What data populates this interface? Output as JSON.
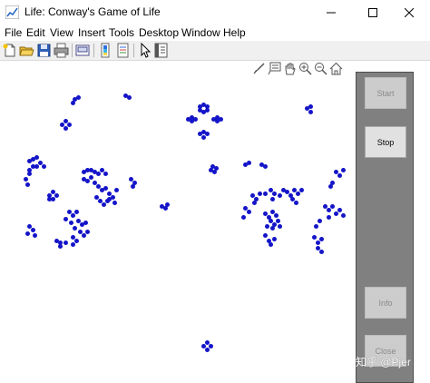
{
  "window": {
    "title": "Life: Conway's Game of Life",
    "controls": [
      "minimize",
      "maximize",
      "close"
    ]
  },
  "menu": [
    "File",
    "Edit",
    "View",
    "Insert",
    "Tools",
    "Desktop",
    "Window",
    "Help"
  ],
  "toolbar": [
    "new-figure-icon",
    "open-file-icon",
    "save-icon",
    "print-icon",
    "link-plot-icon",
    "insert-colorbar-icon",
    "insert-legend-icon",
    "edit-plot-icon",
    "open-property-inspector-icon"
  ],
  "axes_toolbar": [
    "brush-icon",
    "datatip-icon",
    "pan-icon",
    "zoom-in-icon",
    "zoom-out-icon",
    "home-icon"
  ],
  "colors": {
    "cell": "#1414c8",
    "panel": "#808080"
  },
  "controls": {
    "start_label": "Start",
    "stop_label": "Stop",
    "info_label": "Info",
    "close_label": "Close"
  },
  "watermark": "知乎 @Pjer"
}
